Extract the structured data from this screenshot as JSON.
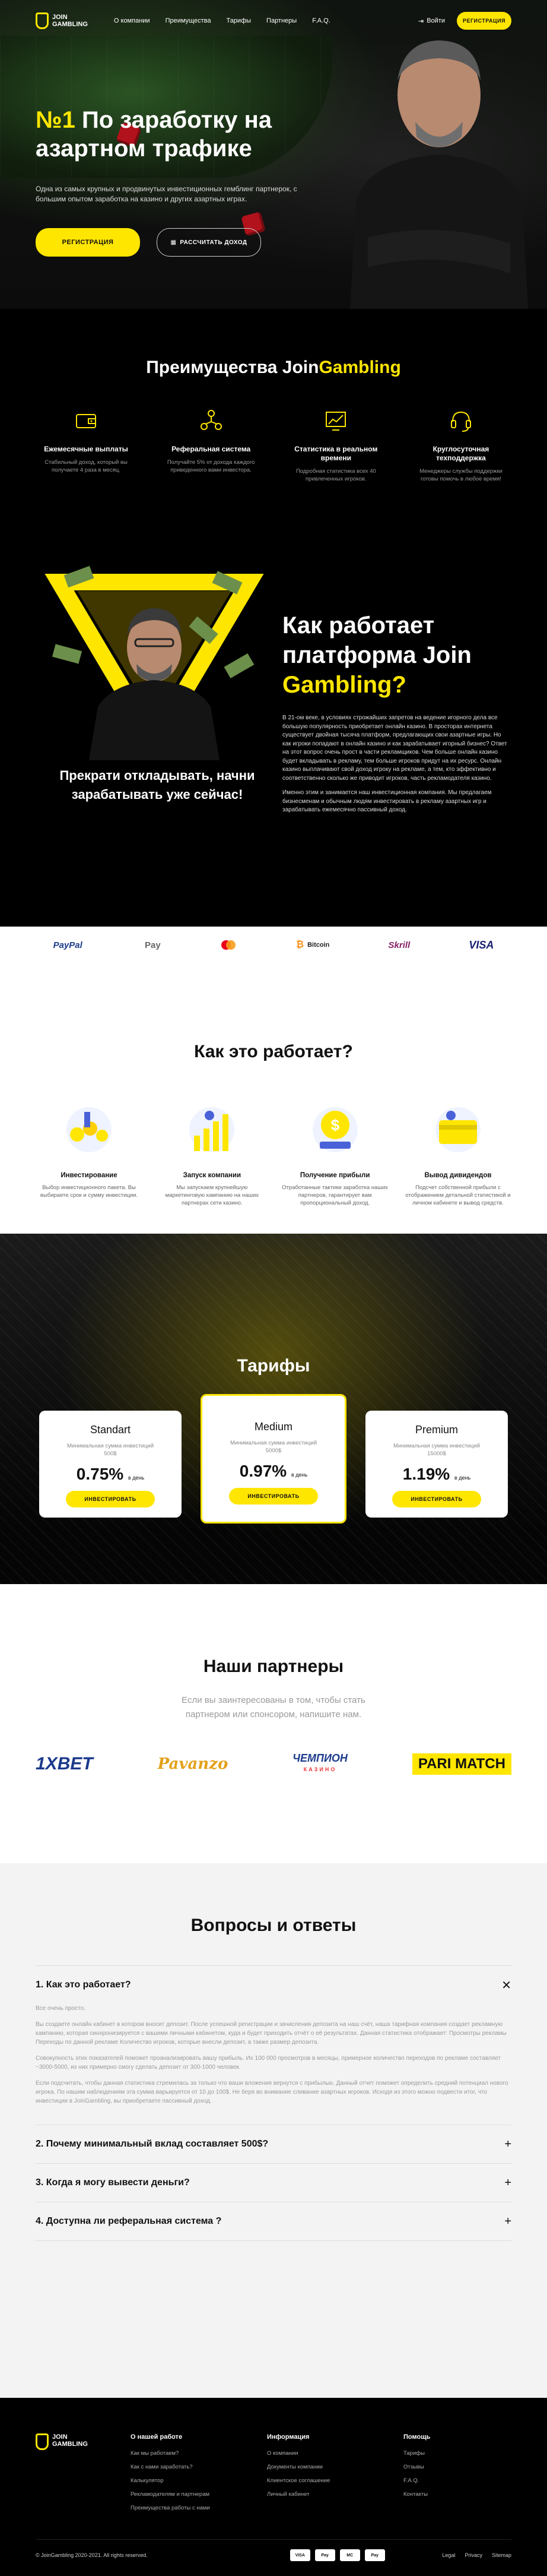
{
  "brand": {
    "logo_line1": "JOIN",
    "logo_line2": "GAMBLING",
    "accent": "#ffe600"
  },
  "nav": {
    "items": [
      "О компании",
      "Преимущества",
      "Тарифы",
      "Партнеры",
      "F.A.Q."
    ],
    "login": "Войти",
    "register": "Регистрация"
  },
  "hero": {
    "title_num": "№1",
    "title_rest": " По заработку на азартном трафике",
    "lead": "Одна из самых крупных и продвинутых инвестиционных гемблинг партнерок, с большим опытом заработка на казино и других азартных играх.",
    "btn_register": "Регистрация",
    "btn_calc": "Рассчитать доход"
  },
  "advantages": {
    "title_plain": "Преимущества Join",
    "title_accent": "Gambling",
    "items": [
      {
        "icon": "wallet-icon",
        "title": "Ежемесячные выплаты",
        "text": "Стабильный доход, который вы получаете 4 раза в месяц."
      },
      {
        "icon": "referral-icon",
        "title": "Реферальная система",
        "text": "Получайте 5% от дохода каждого приведенного вами инвестора."
      },
      {
        "icon": "chart-icon",
        "title": "Статистика в реальном времени",
        "text": "Подробная статистика всех 40 привлеченных игроков."
      },
      {
        "icon": "support-icon",
        "title": "Круглосуточная техподдержка",
        "text": "Менеджеры службы поддержки готовы помочь в любое время!"
      }
    ]
  },
  "platform": {
    "title_plain": "Как работает платформа Join ",
    "title_accent": "Gambling?",
    "p1": "В 21-ом веке, в условиях строжайших запретов на ведение игорного дела все большую популярность приобретает онлайн казино. В просторах интернета существует двойная тысяча платформ, предлагающих свои азартные игры. Но как игроки попадают в онлайн казино и как зарабатывает игорный бизнес? Ответ на этот вопрос очень прост в части рекламщиков. Чем больше онлайн казино будет вкладывать в рекламу, тем больше игроков придут на их ресурс. Онлайн казино выплачивают свой доход игроку на рекламе, а тем, кто эффективно и соответственно сколько же приводит игроков, часть рекламодателя казино.",
    "p2": "Именно этим и занимается наш инвестиционная компания. Мы предлагаем бизнесменам и обычным людям инвестировать в рекламу азартных игр и зарабатывать ежемесячно пассивный доход.",
    "cta": "Прекрати откладывать, начни зарабатывать уже сейчас!"
  },
  "payments": [
    "PayPal",
    "Pay",
    "mastercard",
    "Bitcoin",
    "Skrill",
    "VISA"
  ],
  "how": {
    "title": "Как это работает?",
    "steps": [
      {
        "title": "Инвестирование",
        "text": "Выбор инвестиционного пакета. Вы выбираете срок и сумму инвестиции."
      },
      {
        "title": "Запуск компании",
        "text": "Мы запускаем крупнейшую маркетинговую кампанию на наших партнерах сети казино."
      },
      {
        "title": "Получение прибыли",
        "text": "Отработанные тактики заработка наших партнеров, гарантирует вам пропорциональный доход."
      },
      {
        "title": "Вывод дивидендов",
        "text": "Подсчет собственной прибыли с отображением детальной статистикой и личном кабинете и вывод средств."
      }
    ]
  },
  "tariffs": {
    "title": "Тарифы",
    "items": [
      {
        "name": "Standart",
        "min": "Минимальная сумма инвестиций 500$",
        "rate": "0.75%",
        "unit": "в день",
        "btn": "Инвестировать"
      },
      {
        "name": "Medium",
        "min": "Минимальная сумма инвестиций 5000$",
        "rate": "0.97%",
        "unit": "в день",
        "btn": "Инвестировать"
      },
      {
        "name": "Premium",
        "min": "Минимальная сумма инвестиций 15000$",
        "rate": "1.19%",
        "unit": "в день",
        "btn": "Инвестировать"
      }
    ]
  },
  "partners": {
    "title": "Наши партнеры",
    "sub": "Если вы заинтересованы в том, чтобы стать партнером или спонсором, напишите нам.",
    "logos": [
      "1XBET",
      "Pavanzo",
      "ЧЕМПИОН",
      "PARI MATCH"
    ],
    "champion_sub": "КАЗИНО"
  },
  "faq": {
    "title": "Вопросы и ответы",
    "items": [
      {
        "q": "1. Как это работает?",
        "open": true
      },
      {
        "q": "2. Почему минимальный вклад составляет 500$?",
        "open": false
      },
      {
        "q": "3. Когда я могу вывести деньги?",
        "open": false
      },
      {
        "q": "4. Доступна ли реферальная система ?",
        "open": false
      }
    ],
    "a_intro": "Все очень просто.",
    "a_p1": "Вы создаете онлайн кабинет в котором вносит депозит. После успешной регистрации и зачисления депозита на наш счёт, наша тарифная компания создает рекламную кампанию, которая синхронизируется с вашими личными кабинетом, куда и будет приходить отчёт о её результатах. Данная статистика отображает: Просмотры рекламы Переходы по данной рекламе Количество игроков, которые внесли депозит, а также размер депозита.",
    "a_p2": "Совокупность этих показателей поможет проанализировать вашу прибыль. Их 100 000 просмотров в месяцы, примерное количество переходов по рекламе составляет ~3000-5000, из них примерно смогу сделать депозит от 300-1000 человек.",
    "a_p3": "Если подсчитать, чтобы данная статистика стремилась за только что ваши вложения вернутся с прибылью. Данный отчет поможет определить средний потенциал нового игрока. По нашим наблюдениям эта сумма варьируется от 10 до 100$. Не беря во внимание сливание азартных игроков. Исходя из этого можно подвести итог, что инвестиции в JoinGambling, вы приобретаете пассивный доход."
  },
  "footer": {
    "cols": [
      {
        "title": "О нашей работе",
        "links": [
          "Как мы работаем?",
          "Как с нами заработать?",
          "Калькулятор",
          "Рекламодателям и партнерам",
          "Преимущества работы с нами"
        ]
      },
      {
        "title": "Информация",
        "links": [
          "О компании",
          "Документы компании",
          "Клиентское соглашение",
          "Личный кабинет"
        ]
      },
      {
        "title": "Помощь",
        "links": [
          "Тарифы",
          "Отзывы",
          "F.A.Q.",
          "Контакты"
        ]
      }
    ],
    "copyright": "© JoinGambling 2020-2021. All rights reserved.",
    "pay": [
      "VISA",
      "Pay",
      "MC",
      "Pay"
    ],
    "links": [
      "Legal",
      "Privacy",
      "Sitemap"
    ]
  }
}
